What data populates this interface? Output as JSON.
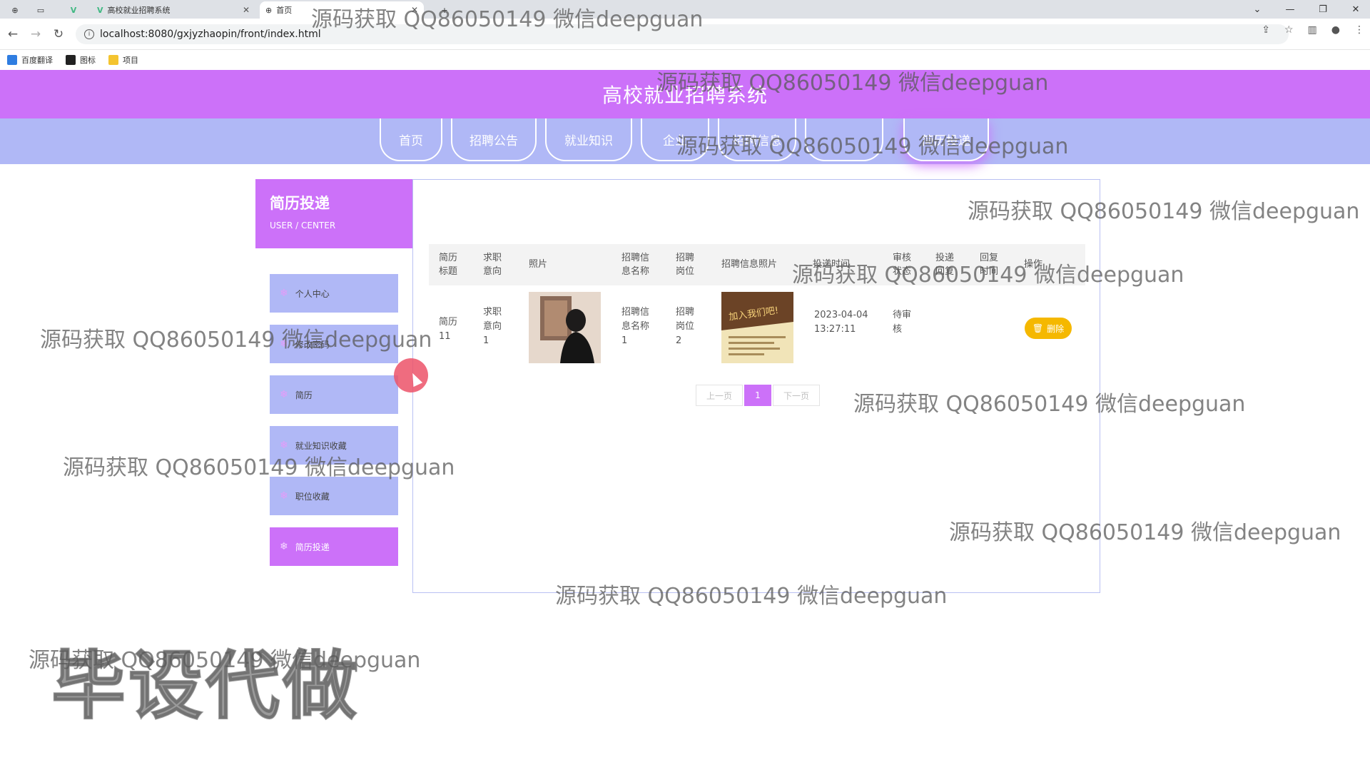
{
  "browser": {
    "tabs": [
      {
        "title": "高校就业招聘系统",
        "active": false
      },
      {
        "title": "首页",
        "active": true
      }
    ],
    "url": "localhost:8080/gxjyzhaopin/front/index.html",
    "bookmarks": [
      "百度翻译",
      "图标",
      "项目"
    ]
  },
  "site": {
    "title": "高校就业招聘系统",
    "nav": [
      "首页",
      "招聘公告",
      "就业知识",
      "企业",
      "招聘信息",
      "",
      "简历投递"
    ],
    "active_nav": "简历投递"
  },
  "sidebar": {
    "title": "简历投递",
    "subtitle": "USER / CENTER",
    "items": [
      {
        "label": "个人中心",
        "active": false
      },
      {
        "label": "修改密码",
        "active": false
      },
      {
        "label": "简历",
        "active": false
      },
      {
        "label": "就业知识收藏",
        "active": false
      },
      {
        "label": "职位收藏",
        "active": false
      },
      {
        "label": "简历投递",
        "active": true
      }
    ]
  },
  "table": {
    "headers": [
      "简历\n标题",
      "求职\n意向",
      "照片",
      "招聘信\n息名称",
      "招聘\n岗位",
      "招聘信息照片",
      "投递时间",
      "审核\n状态",
      "投递\n回复",
      "回复\n时间",
      "操作"
    ],
    "rows": [
      {
        "title": "简历\n11",
        "intent": "求职\n意向\n1",
        "info_name": "招聘信\n息名称\n1",
        "post": "招聘\n岗位\n2",
        "poster_text": "加入我们吧!",
        "time": "2023-04-04\n13:27:11",
        "status": "待审\n核",
        "reply": "",
        "reply_time": "",
        "action": "删除"
      }
    ]
  },
  "pagination": {
    "prev": "上一页",
    "current": "1",
    "next": "下一页"
  },
  "watermarks": {
    "text": "源码获取 QQ86050149 微信deepguan",
    "stamp": "毕设代做"
  },
  "colors": {
    "primary": "#cc71f9",
    "nav": "#b0b8f6",
    "danger_btn": "#f5b800"
  }
}
